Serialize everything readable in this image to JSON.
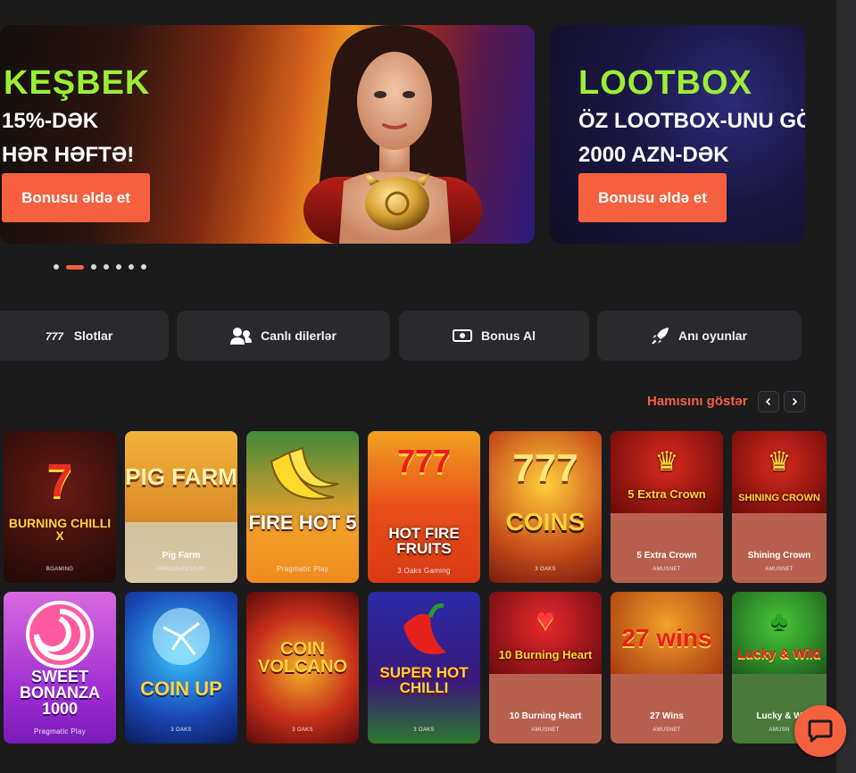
{
  "banners": [
    {
      "title": "KEŞBEK",
      "line1": "15%-DƏK",
      "line2": "HƏR HƏFTƏ!",
      "button": "Bonusu əldə et"
    },
    {
      "title": "LOOTBOX",
      "line1": "ÖZ LOOTBOX-UNU GÖ",
      "line2": "2000 AZN-DƏK",
      "button": "Bonusu əldə et"
    }
  ],
  "carousel": {
    "count": 7,
    "active_index": 1
  },
  "categories": [
    {
      "label": "Slotlar",
      "icon": "777-icon"
    },
    {
      "label": "Canlı dilerlər",
      "icon": "users-icon"
    },
    {
      "label": "Bonus Al",
      "icon": "money-icon"
    },
    {
      "label": "Anı oyunlar",
      "icon": "rocket-icon"
    }
  ],
  "games_section": {
    "show_all": "Hamısını göstər"
  },
  "games": [
    {
      "title": "BURNING CHILLI X",
      "name": "",
      "provider": "BGAMING"
    },
    {
      "title": "PIG FARM",
      "name": "Pig Farm",
      "provider": "PRAGMATICPLAY"
    },
    {
      "title": "FIRE HOT 5",
      "name": "Pragmatic Play",
      "provider": ""
    },
    {
      "title": "HOT FIRE FRUITS",
      "name": "3 Oaks Gaming",
      "provider": ""
    },
    {
      "title": "COINS",
      "name": "",
      "provider": "3 OAKS"
    },
    {
      "title": "5 Extra Crown",
      "name": "5 Extra Crown",
      "provider": "AMUSNET"
    },
    {
      "title": "SHINING CROWN",
      "name": "Shining Crown",
      "provider": "AMUSNET"
    },
    {
      "title": "SWEET BONANZA 1000",
      "name": "Pragmatic Play",
      "provider": ""
    },
    {
      "title": "COIN UP",
      "name": "",
      "provider": "3 OAKS"
    },
    {
      "title": "COIN VOLCANO",
      "name": "",
      "provider": "3 OAKS"
    },
    {
      "title": "SUPER HOT CHILLI",
      "name": "",
      "provider": "3 OAKS"
    },
    {
      "title": "10 Burning Heart",
      "name": "10 Burning Heart",
      "provider": "AMUSNET"
    },
    {
      "title": "27 wins",
      "name": "27 Wins",
      "provider": "AMUSNET"
    },
    {
      "title": "Lucky & Wild",
      "name": "Lucky & W",
      "provider": "AMUSN"
    }
  ],
  "colors": {
    "accent": "#f5613f",
    "lime": "#9bee35",
    "background": "#1b1b1c",
    "tab": "#2a2a2c"
  }
}
